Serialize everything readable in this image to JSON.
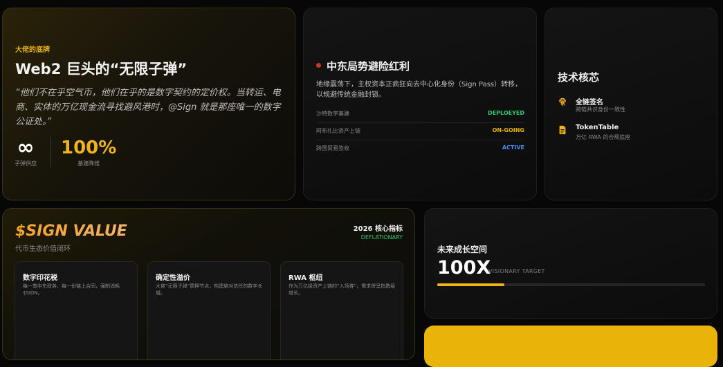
{
  "card1": {
    "kicker": "大佬的底牌",
    "title": "Web2 巨头的“无限子弹”",
    "quote": "“他们不在乎空气币，他们在乎的是数字契约的定价权。当转运、电商、实体的万亿现金流寻找避风港时，@Sign 就是那座唯一的数字公证处。”",
    "stats": [
      {
        "value": "∞",
        "label": "子弹供应"
      },
      {
        "value": "100%",
        "label": "基建降维"
      }
    ]
  },
  "card2": {
    "title": "中东局势避险红利",
    "description": "地缘震荡下，主权资本正疯狂向去中心化身份（Sign Pass）转移，以规避传统金融封锁。",
    "rows": [
      {
        "name": "沙特数字基建",
        "status": "DEPLOEYED",
        "color": "#2ecc71"
      },
      {
        "name": "阿布扎比资产上链",
        "status": "ON-GOING",
        "color": "#e9b213"
      },
      {
        "name": "跨国贸易签收",
        "status": "ACTIVE",
        "color": "#4a8ef0"
      }
    ]
  },
  "card3": {
    "title": "技术核芯",
    "items": [
      {
        "icon": "fingerprint-icon",
        "title": "全链签名",
        "subtitle": "跨链共识身份一致性"
      },
      {
        "icon": "document-icon",
        "title": "TokenTable",
        "subtitle": "万亿 RWA 的合规底座"
      }
    ]
  },
  "card4": {
    "title": "$SIGN VALUE",
    "subtitle": "代币生态价值闭环",
    "metric_title": "2026 核心指标",
    "metric_tag": "DEFLATIONARY",
    "features": [
      {
        "title": "数字印花税",
        "desc": "每一笔中东政务、每一份链上合同，强制消耗 $SIGN。"
      },
      {
        "title": "确定性溢价",
        "desc": "大佬“无限子弹”质押节点，构建绝对信任的数字长城。"
      },
      {
        "title": "RWA 枢纽",
        "desc": "作为万亿级资产上链的“入场券”，需求将呈指数级增长。"
      }
    ]
  },
  "card5": {
    "title": "未来成长空间",
    "value": "100X",
    "tag": "VISIONARY TARGET",
    "progress": 0.25
  },
  "colors": {
    "accent": "#f2b315",
    "background": "#070707",
    "deployed": "#2ecc71",
    "ongoing": "#e9b213",
    "active": "#4a8ef0",
    "alert_dot": "#c0392b"
  }
}
